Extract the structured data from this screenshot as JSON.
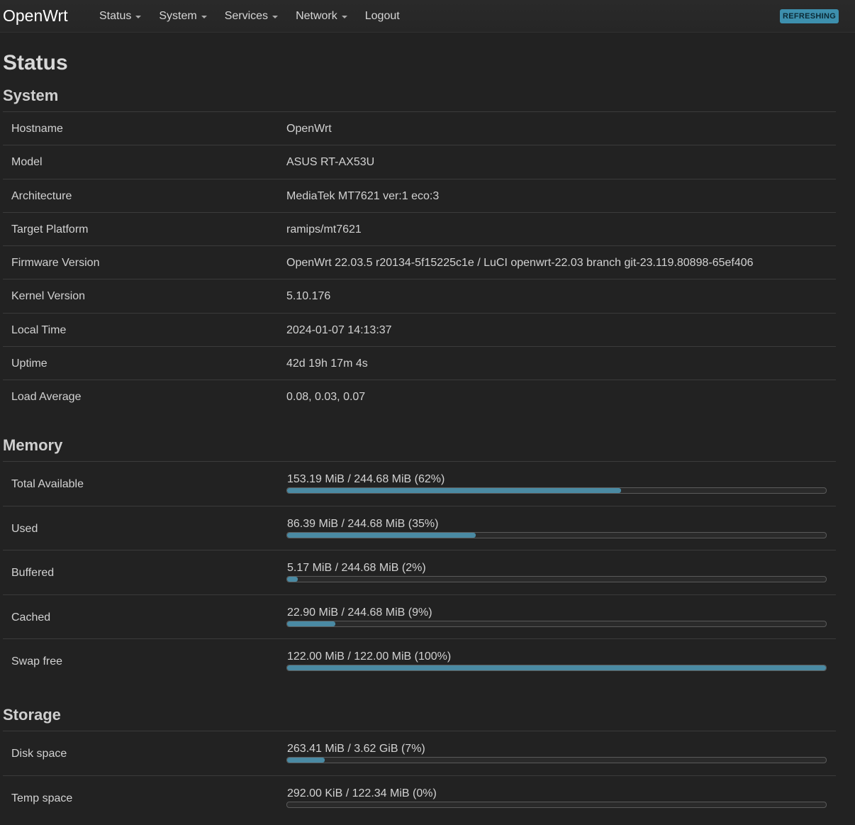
{
  "nav": {
    "brand": "OpenWrt",
    "items": [
      {
        "label": "Status",
        "dropdown": true
      },
      {
        "label": "System",
        "dropdown": true
      },
      {
        "label": "Services",
        "dropdown": true
      },
      {
        "label": "Network",
        "dropdown": true
      },
      {
        "label": "Logout",
        "dropdown": false
      }
    ],
    "refresh_badge": "REFRESHING"
  },
  "page_title": "Status",
  "system": {
    "title": "System",
    "rows": [
      {
        "label": "Hostname",
        "value": "OpenWrt"
      },
      {
        "label": "Model",
        "value": "ASUS RT-AX53U"
      },
      {
        "label": "Architecture",
        "value": "MediaTek MT7621 ver:1 eco:3"
      },
      {
        "label": "Target Platform",
        "value": "ramips/mt7621"
      },
      {
        "label": "Firmware Version",
        "value": "OpenWrt 22.03.5 r20134-5f15225c1e / LuCI openwrt-22.03 branch git-23.119.80898-65ef406"
      },
      {
        "label": "Kernel Version",
        "value": "5.10.176"
      },
      {
        "label": "Local Time",
        "value": "2024-01-07 14:13:37"
      },
      {
        "label": "Uptime",
        "value": "42d 19h 17m 4s"
      },
      {
        "label": "Load Average",
        "value": "0.08, 0.03, 0.07"
      }
    ]
  },
  "memory": {
    "title": "Memory",
    "rows": [
      {
        "label": "Total Available",
        "text": "153.19 MiB / 244.68 MiB (62%)",
        "percent": 62
      },
      {
        "label": "Used",
        "text": "86.39 MiB / 244.68 MiB (35%)",
        "percent": 35
      },
      {
        "label": "Buffered",
        "text": "5.17 MiB / 244.68 MiB (2%)",
        "percent": 2
      },
      {
        "label": "Cached",
        "text": "22.90 MiB / 244.68 MiB (9%)",
        "percent": 9
      },
      {
        "label": "Swap free",
        "text": "122.00 MiB / 122.00 MiB (100%)",
        "percent": 100
      }
    ]
  },
  "storage": {
    "title": "Storage",
    "rows": [
      {
        "label": "Disk space",
        "text": "263.41 MiB / 3.62 GiB (7%)",
        "percent": 7
      },
      {
        "label": "Temp space",
        "text": "292.00 KiB / 122.34 MiB (0%)",
        "percent": 0
      }
    ]
  },
  "colors": {
    "background": "#222222",
    "bar_fill": "#4a8aa3",
    "badge": "#3d8fad"
  }
}
